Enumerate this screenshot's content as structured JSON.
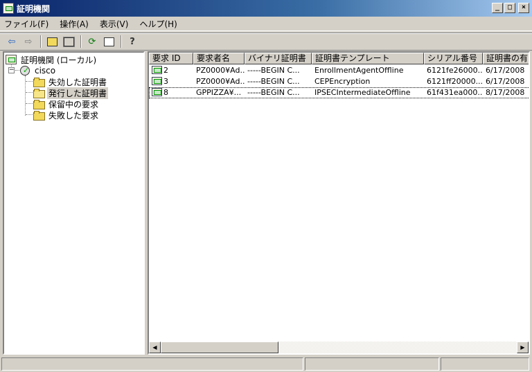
{
  "window": {
    "title": "証明機関"
  },
  "menu": [
    {
      "label": "ファイル(F)"
    },
    {
      "label": "操作(A)"
    },
    {
      "label": "表示(V)"
    },
    {
      "label": "ヘルプ(H)"
    }
  ],
  "toolbar": {
    "icons": [
      "back-arrow-icon",
      "forward-arrow-icon",
      "up-folder-icon",
      "show-hide-tree-icon",
      "refresh-icon",
      "export-list-icon",
      "help-icon"
    ]
  },
  "tree": {
    "root": "証明機関 (ローカル)",
    "server": "cisco",
    "folders": [
      {
        "label": "失効した証明書"
      },
      {
        "label": "発行した証明書"
      },
      {
        "label": "保留中の要求"
      },
      {
        "label": "失敗した要求"
      }
    ],
    "selected_index": 1
  },
  "list": {
    "columns": [
      "要求 ID",
      "要求者名",
      "バイナリ証明書",
      "証明書テンプレート",
      "シリアル番号",
      "証明書の有"
    ],
    "rows": [
      {
        "id": "2",
        "requester": "PZ0000¥Ad...",
        "binary": "-----BEGIN C...",
        "template": "EnrollmentAgentOffline",
        "serial": "6121fe26000...",
        "date": "6/17/2008"
      },
      {
        "id": "3",
        "requester": "PZ0000¥Ad...",
        "binary": "-----BEGIN C...",
        "template": "CEPEncryption",
        "serial": "6121ff20000...",
        "date": "6/17/2008"
      },
      {
        "id": "8",
        "requester": "GPPIZZA¥...",
        "binary": "-----BEGIN C...",
        "template": "IPSECIntermediateOffline",
        "serial": "61f431ea000...",
        "date": "8/17/2008"
      }
    ],
    "selected_row": 2
  },
  "statusbar": {
    "segments": [
      "",
      "",
      ""
    ]
  }
}
